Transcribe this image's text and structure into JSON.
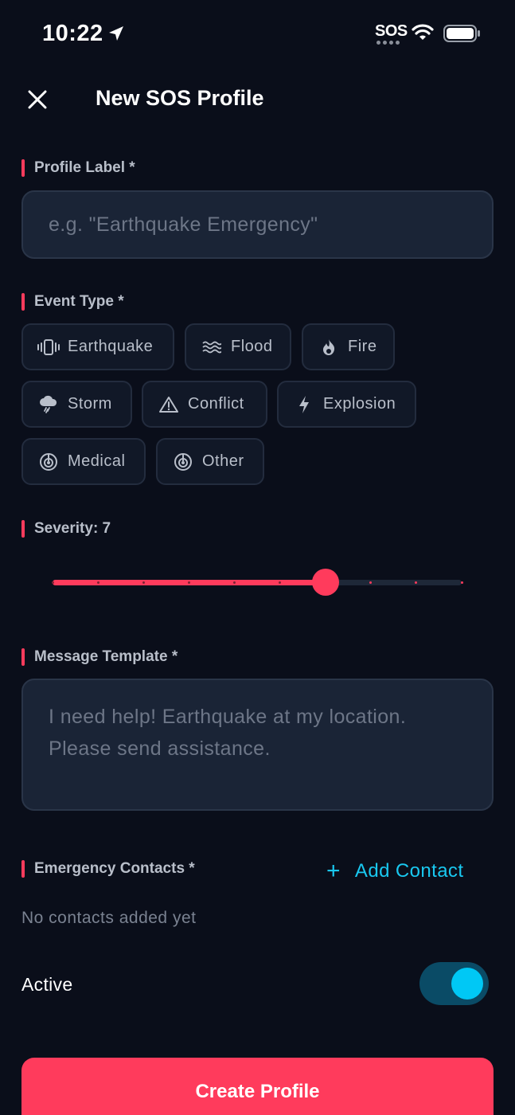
{
  "status_bar": {
    "time": "10:22",
    "sos_indicator": "SOS"
  },
  "header": {
    "title": "New SOS Profile"
  },
  "profile_label": {
    "label": "Profile Label *",
    "placeholder": "e.g. \"Earthquake Emergency\""
  },
  "event_type": {
    "label": "Event Type *",
    "options": [
      {
        "label": "Earthquake",
        "icon": "vibrate-icon"
      },
      {
        "label": "Flood",
        "icon": "waves-icon"
      },
      {
        "label": "Fire",
        "icon": "flame-icon"
      },
      {
        "label": "Storm",
        "icon": "storm-cloud-icon"
      },
      {
        "label": "Conflict",
        "icon": "warning-icon"
      },
      {
        "label": "Explosion",
        "icon": "lightning-icon"
      },
      {
        "label": "Medical",
        "icon": "radar-icon"
      },
      {
        "label": "Other",
        "icon": "radar-icon"
      }
    ]
  },
  "severity": {
    "label": "Severity: 7",
    "value": 7,
    "min": 1,
    "max": 10
  },
  "message_template": {
    "label": "Message Template *",
    "placeholder_line1": "I need help! Earthquake at my location.",
    "placeholder_line2": "Please send assistance."
  },
  "contacts": {
    "label": "Emergency Contacts *",
    "add_label": "Add Contact",
    "empty_text": "No contacts added yet"
  },
  "active": {
    "label": "Active",
    "enabled": true
  },
  "actions": {
    "create_label": "Create Profile"
  },
  "colors": {
    "background": "#0a0e1a",
    "accent": "#ff3b5c",
    "link": "#19c8f0",
    "toggle_on": "#00c8f5"
  }
}
